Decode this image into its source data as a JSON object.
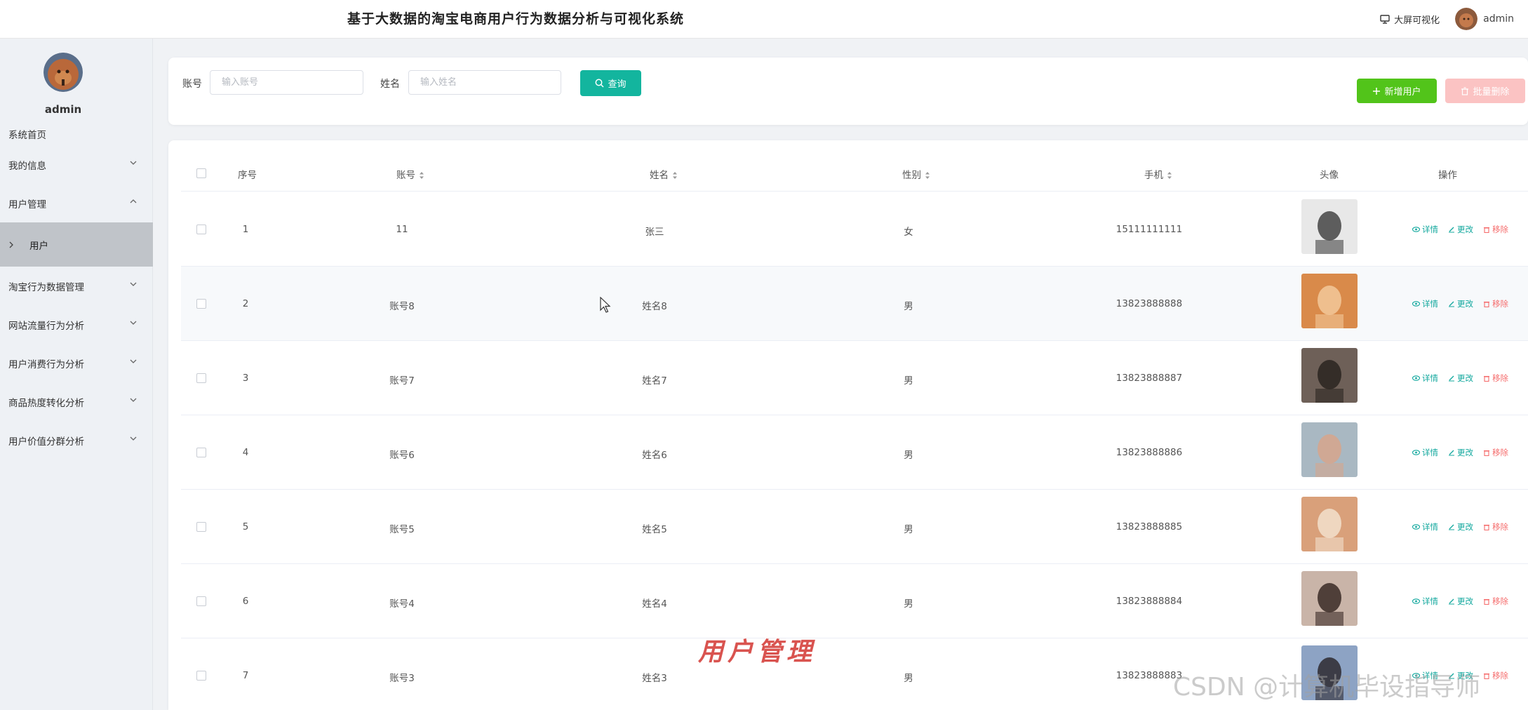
{
  "header": {
    "title": "基于大数据的淘宝电商用户行为数据分析与可视化系统",
    "big_screen_label": "大屏可视化",
    "username": "admin"
  },
  "sidebar": {
    "username": "admin",
    "items": [
      {
        "label": "系统首页"
      },
      {
        "label": "我的信息"
      },
      {
        "label": "用户管理"
      },
      {
        "label": "淘宝行为数据管理"
      },
      {
        "label": "网站流量行为分析"
      },
      {
        "label": "用户消费行为分析"
      },
      {
        "label": "商品热度转化分析"
      },
      {
        "label": "用户价值分群分析"
      }
    ],
    "active_sub": {
      "label": "用户"
    }
  },
  "search": {
    "account_label": "账号",
    "account_placeholder": "输入账号",
    "name_label": "姓名",
    "name_placeholder": "输入姓名",
    "query_label": "查询",
    "add_label": "新增用户",
    "batch_delete_label": "批量删除"
  },
  "table": {
    "columns": {
      "index": "序号",
      "account": "账号",
      "name": "姓名",
      "gender": "性别",
      "phone": "手机",
      "avatar": "头像",
      "actions": "操作"
    },
    "action_labels": {
      "detail": "详情",
      "edit": "更改",
      "remove": "移除"
    },
    "rows": [
      {
        "index": "1",
        "account": "11",
        "name": "张三",
        "gender": "女",
        "phone": "15111111111"
      },
      {
        "index": "2",
        "account": "账号8",
        "name": "姓名8",
        "gender": "男",
        "phone": "13823888888"
      },
      {
        "index": "3",
        "account": "账号7",
        "name": "姓名7",
        "gender": "男",
        "phone": "13823888887"
      },
      {
        "index": "4",
        "account": "账号6",
        "name": "姓名6",
        "gender": "男",
        "phone": "13823888886"
      },
      {
        "index": "5",
        "account": "账号5",
        "name": "姓名5",
        "gender": "男",
        "phone": "13823888885"
      },
      {
        "index": "6",
        "account": "账号4",
        "name": "姓名4",
        "gender": "男",
        "phone": "13823888884"
      },
      {
        "index": "7",
        "account": "账号3",
        "name": "姓名3",
        "gender": "男",
        "phone": "13823888883"
      }
    ]
  },
  "overlay": {
    "caption": "用户管理",
    "watermark": "CSDN @计算机毕设指导师"
  },
  "colors": {
    "accent_teal": "#13b59e",
    "add_green": "#52c41a",
    "batch_delete_pink": "#fbc3c3",
    "remove_red": "#f56c6c",
    "sidebar_bg": "#eef1f5",
    "sidebar_active": "#c0c4c9"
  }
}
